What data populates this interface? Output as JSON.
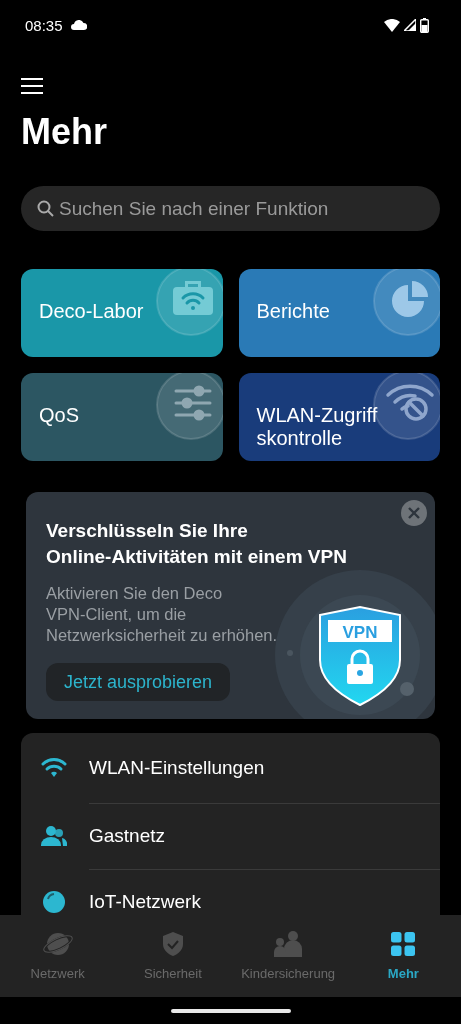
{
  "status_bar": {
    "time": "08:35"
  },
  "header": {
    "title": "Mehr"
  },
  "search": {
    "placeholder": "Suchen Sie nach einer Funktion"
  },
  "tiles": [
    {
      "label": "Deco-Labor",
      "kind": "lab",
      "color": "#1a97a8"
    },
    {
      "label": "Berichte",
      "kind": "reports",
      "color": "#2a7ab6"
    },
    {
      "label": "QoS",
      "kind": "qos",
      "color": "#2c5662"
    },
    {
      "label": "WLAN-Zugriffskontrolle",
      "kind": "access",
      "color": "#193c7b"
    }
  ],
  "promo": {
    "title_lines": [
      "Verschlüsseln Sie Ihre",
      "Online-Aktivitäten mit einem VPN"
    ],
    "text_lines": [
      "Aktivieren Sie den Deco",
      "VPN-Client, um die",
      "Netzwerksicherheit zu erhöhen."
    ],
    "button": "Jetzt ausprobieren",
    "badge": "VPN"
  },
  "settings": [
    {
      "label": "WLAN-Einstellungen",
      "kind": "wifi"
    },
    {
      "label": "Gastnetz",
      "kind": "guests"
    },
    {
      "label": "IoT-Netzwerk",
      "kind": "iot"
    }
  ],
  "nav": [
    {
      "label": "Netzwerk",
      "kind": "network",
      "selected": false
    },
    {
      "label": "Sicherheit",
      "kind": "security",
      "selected": false
    },
    {
      "label": "Kindersicherung",
      "kind": "parental",
      "selected": false
    },
    {
      "label": "Mehr",
      "kind": "more",
      "selected": true
    }
  ]
}
